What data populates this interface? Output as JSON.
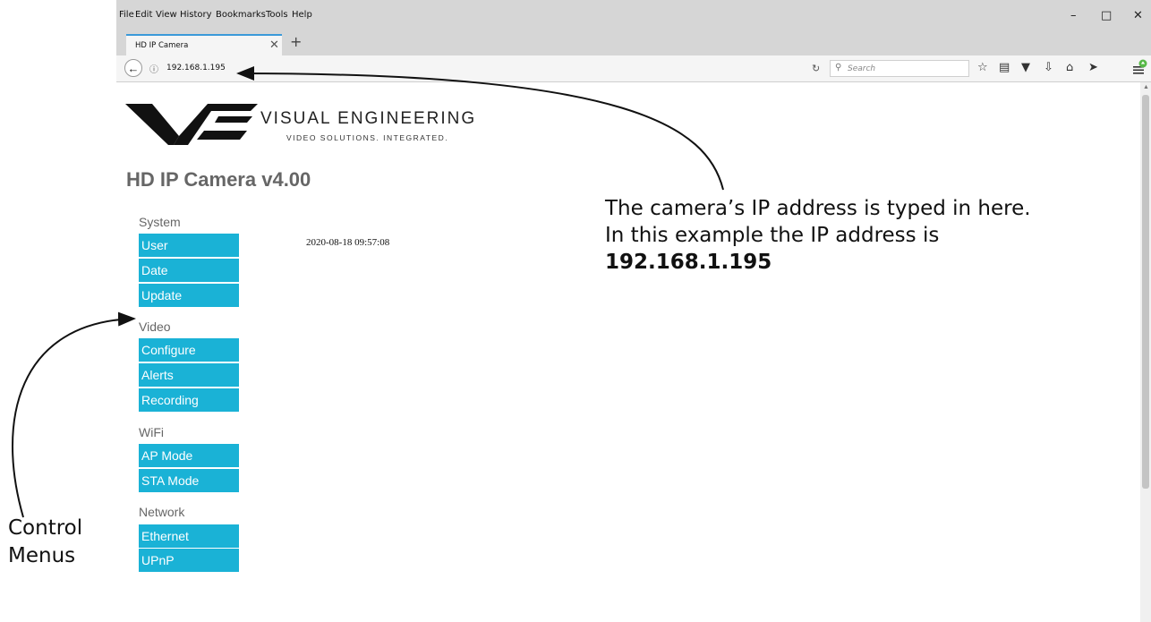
{
  "browser": {
    "menu": [
      "File",
      "Edit",
      "View",
      "History",
      "Bookmarks",
      "Tools",
      "Help"
    ],
    "window_controls": {
      "minimize": "–",
      "restore": "□",
      "close": "✕"
    },
    "tab": {
      "title": "HD IP Camera",
      "close": "✕",
      "new_tab": "+"
    },
    "url": "192.168.1.195",
    "search_placeholder": "Search"
  },
  "page": {
    "logo": {
      "name": "VISUAL ENGINEERING",
      "tagline": "VIDEO SOLUTIONS. INTEGRATED."
    },
    "title": "HD IP Camera v4.00",
    "datetime": "2020-08-18 09:57:08",
    "sections": [
      {
        "label": "System",
        "items": [
          "User",
          "Date",
          "Update"
        ]
      },
      {
        "label": "Video",
        "items": [
          "Configure",
          "Alerts",
          "Recording"
        ]
      },
      {
        "label": "WiFi",
        "items": [
          "AP Mode",
          "STA Mode"
        ]
      },
      {
        "label": "Network",
        "items": [
          "Ethernet",
          "UPnP"
        ]
      }
    ],
    "button_color": "#1ab2d6"
  },
  "annotations": {
    "ip_note": {
      "line1": "The camera’s IP address is typed in here.",
      "line2": "In this example the IP address is",
      "line3": "192.168.1.195"
    },
    "menu_note": {
      "line1": "Control",
      "line2": "Menus"
    }
  }
}
